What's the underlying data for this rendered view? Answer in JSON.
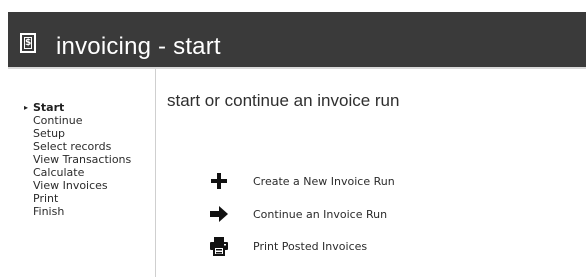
{
  "window": {
    "title": "invoicing - start",
    "title_icon": "dollar-document-icon"
  },
  "sidebar": {
    "steps": [
      {
        "label": "Start",
        "active": true
      },
      {
        "label": "Continue",
        "active": false
      },
      {
        "label": "Setup",
        "active": false
      },
      {
        "label": "Select records",
        "active": false
      },
      {
        "label": "View Transactions",
        "active": false
      },
      {
        "label": "Calculate",
        "active": false
      },
      {
        "label": "View Invoices",
        "active": false
      },
      {
        "label": "Print",
        "active": false
      },
      {
        "label": "Finish",
        "active": false
      }
    ],
    "active_marker": "▸"
  },
  "main": {
    "title": "start or continue an invoice run",
    "actions": [
      {
        "label": "Create a New Invoice Run",
        "icon": "plus-icon"
      },
      {
        "label": "Continue an Invoice Run",
        "icon": "arrow-right-icon"
      },
      {
        "label": "Print Posted Invoices",
        "icon": "printer-icon"
      }
    ]
  },
  "colors": {
    "topbar": "#3a3a3a",
    "title_text": "#ffffff",
    "body_text": "#2b2b2b",
    "divider": "#cfcfcf"
  }
}
